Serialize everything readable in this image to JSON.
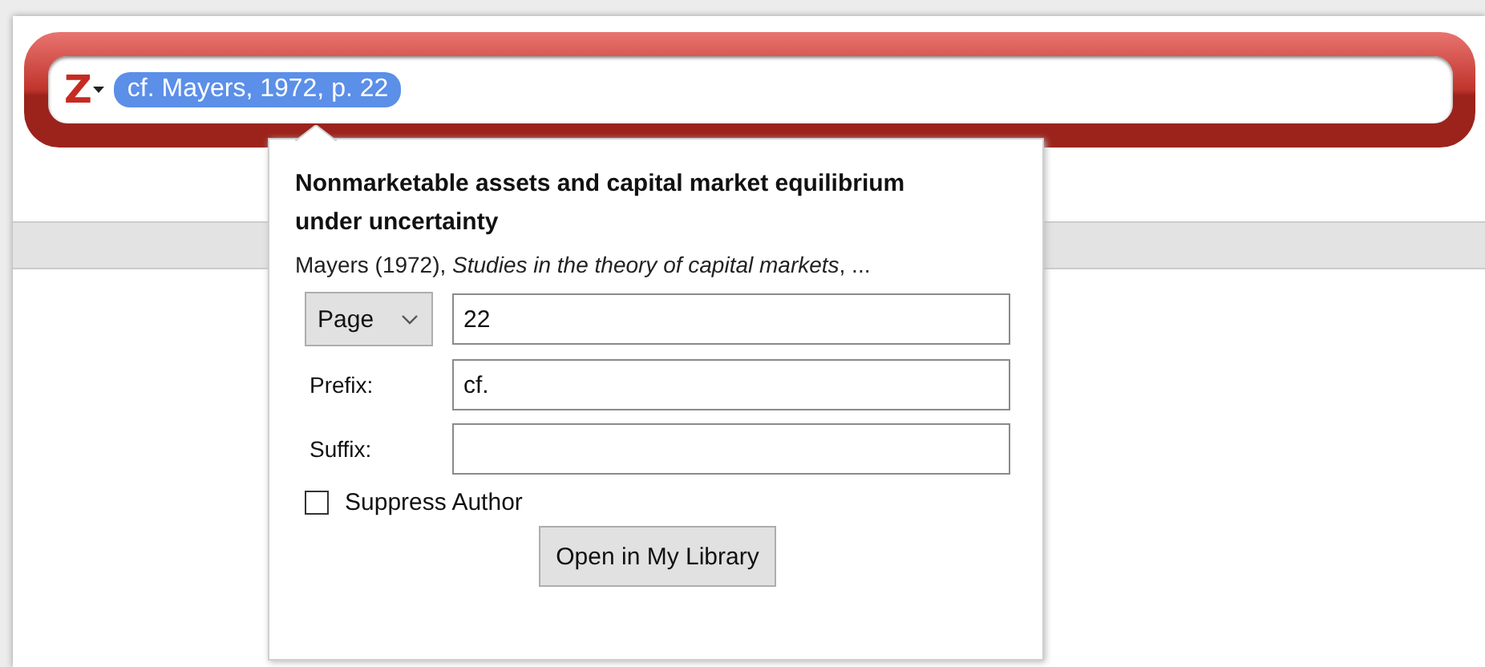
{
  "quick_format": {
    "logo": "Z",
    "bubble": "cf. Mayers, 1972, p. 22"
  },
  "popup": {
    "title": "Nonmarketable assets and capital market equilibrium under uncertainty",
    "citation": "Mayers (1972), *Studies in the theory of capital markets*, ...",
    "locator": {
      "label": "Page",
      "value": "22"
    },
    "prefix": {
      "label": "Prefix:",
      "value": "cf."
    },
    "suffix": {
      "label": "Suffix:"
    },
    "suppress_author": {
      "label": "Suppress Author",
      "checked": false
    },
    "button": "Open in My Library"
  }
}
